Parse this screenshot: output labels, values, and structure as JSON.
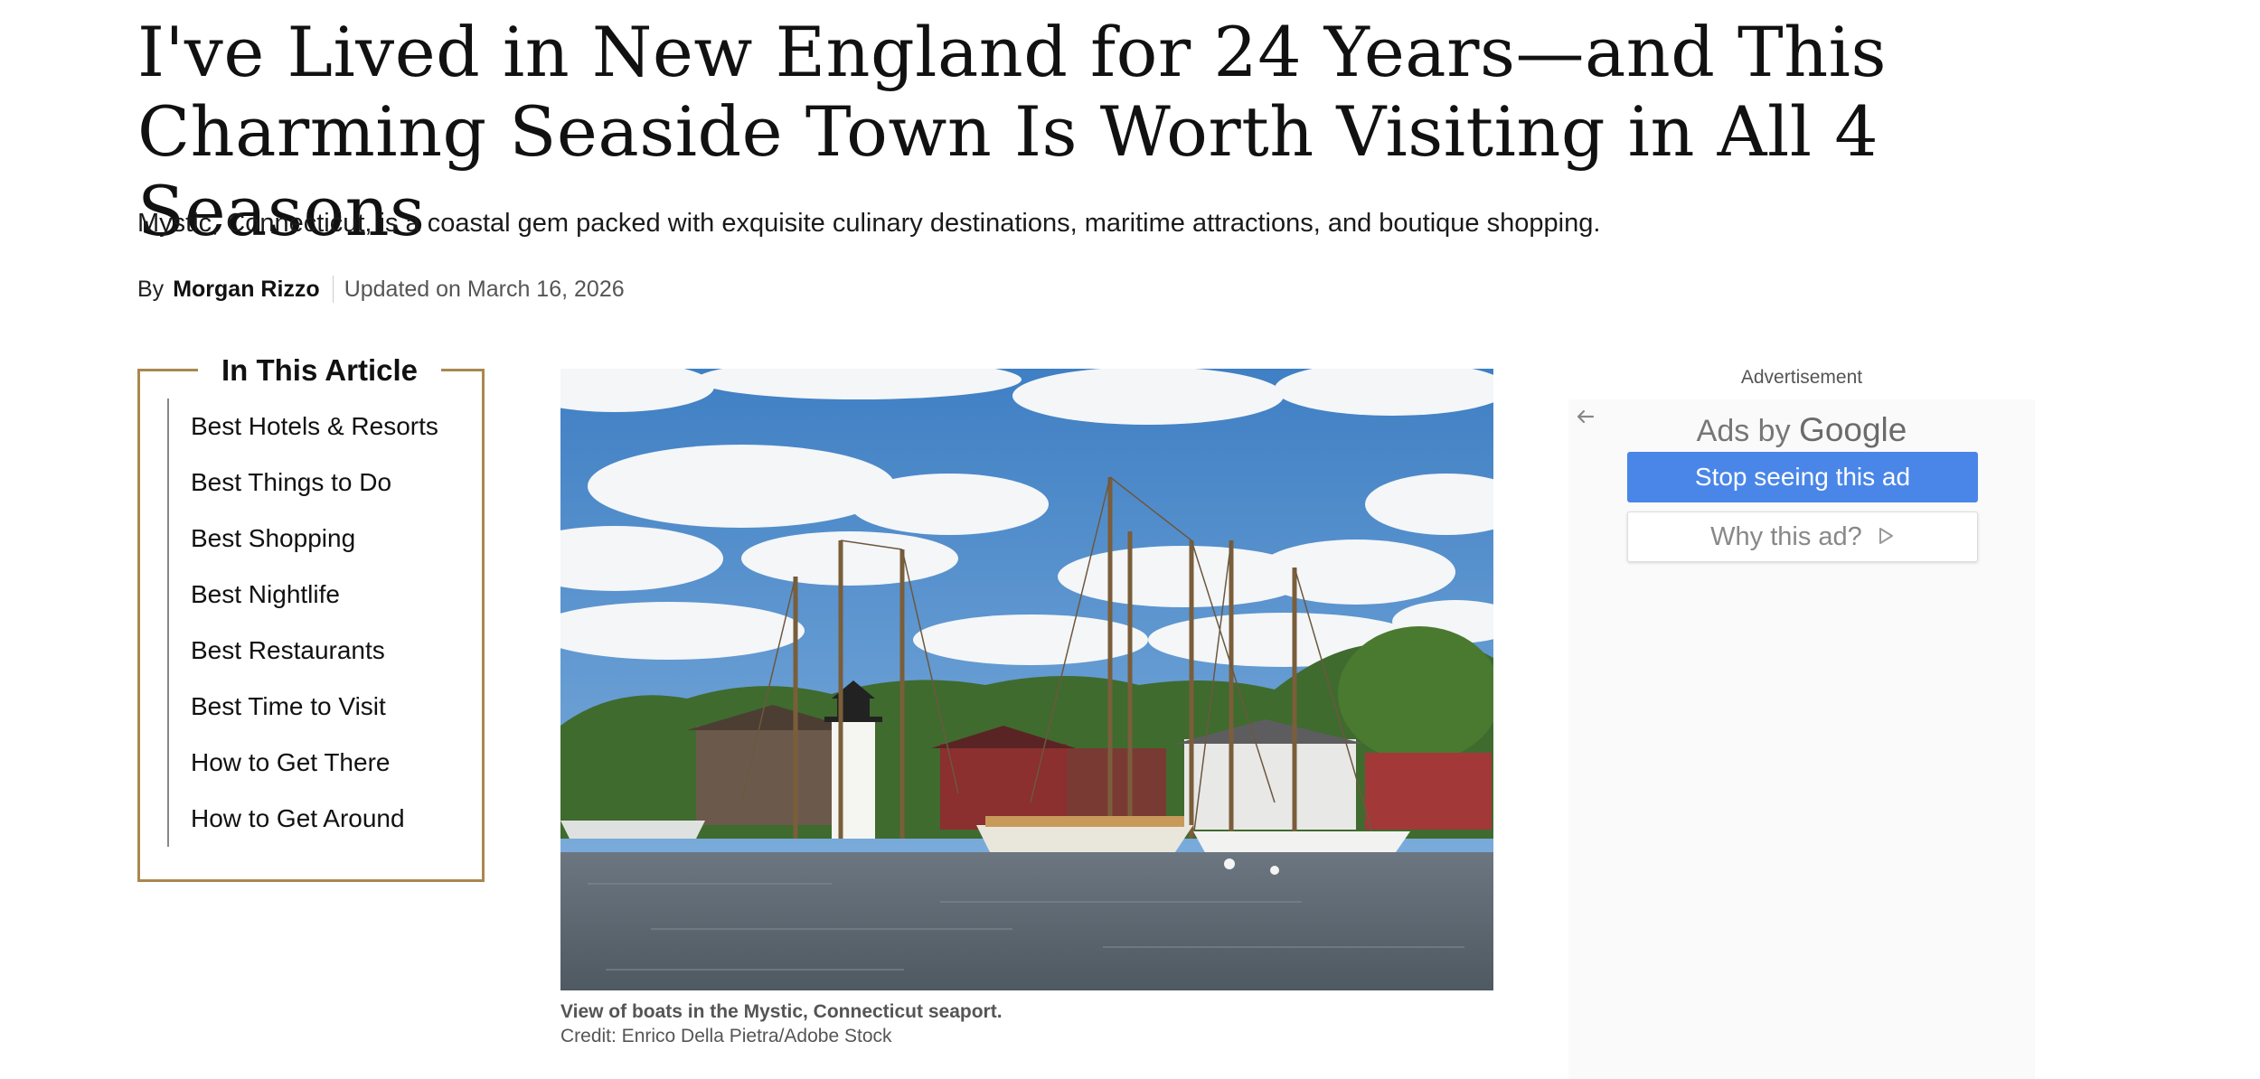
{
  "article": {
    "title": "I've Lived in New England for 24 Years—and This Charming Seaside Town Is Worth Visiting in All 4 Seasons",
    "dek": "Mystic, Connecticut, is a coastal gem packed with exquisite culinary destinations, maritime attractions, and boutique shopping.",
    "byline": {
      "prefix": "By",
      "author": "Morgan Rizzo",
      "updated": "Updated on March 16, 2026"
    }
  },
  "toc": {
    "title": "In This Article",
    "items": [
      "Best Hotels & Resorts",
      "Best Things to Do",
      "Best Shopping",
      "Best Nightlife",
      "Best Restaurants",
      "Best Time to Visit",
      "How to Get There",
      "How to Get Around"
    ]
  },
  "hero": {
    "caption": "View of boats in the Mystic, Connecticut seaport.",
    "credit": "Credit: Enrico Della Pietra/Adobe Stock"
  },
  "ad": {
    "label": "Advertisement",
    "ads_by_prefix": "Ads by",
    "ads_by_brand": "Google",
    "stop_button": "Stop seeing this ad",
    "why_button": "Why this ad?",
    "back_icon": "arrow-left-icon",
    "why_icon": "adchoices-play-icon"
  },
  "colors": {
    "toc_border": "#a9884e",
    "ad_button_blue": "#4a86e8",
    "caption_gray": "#555555"
  }
}
